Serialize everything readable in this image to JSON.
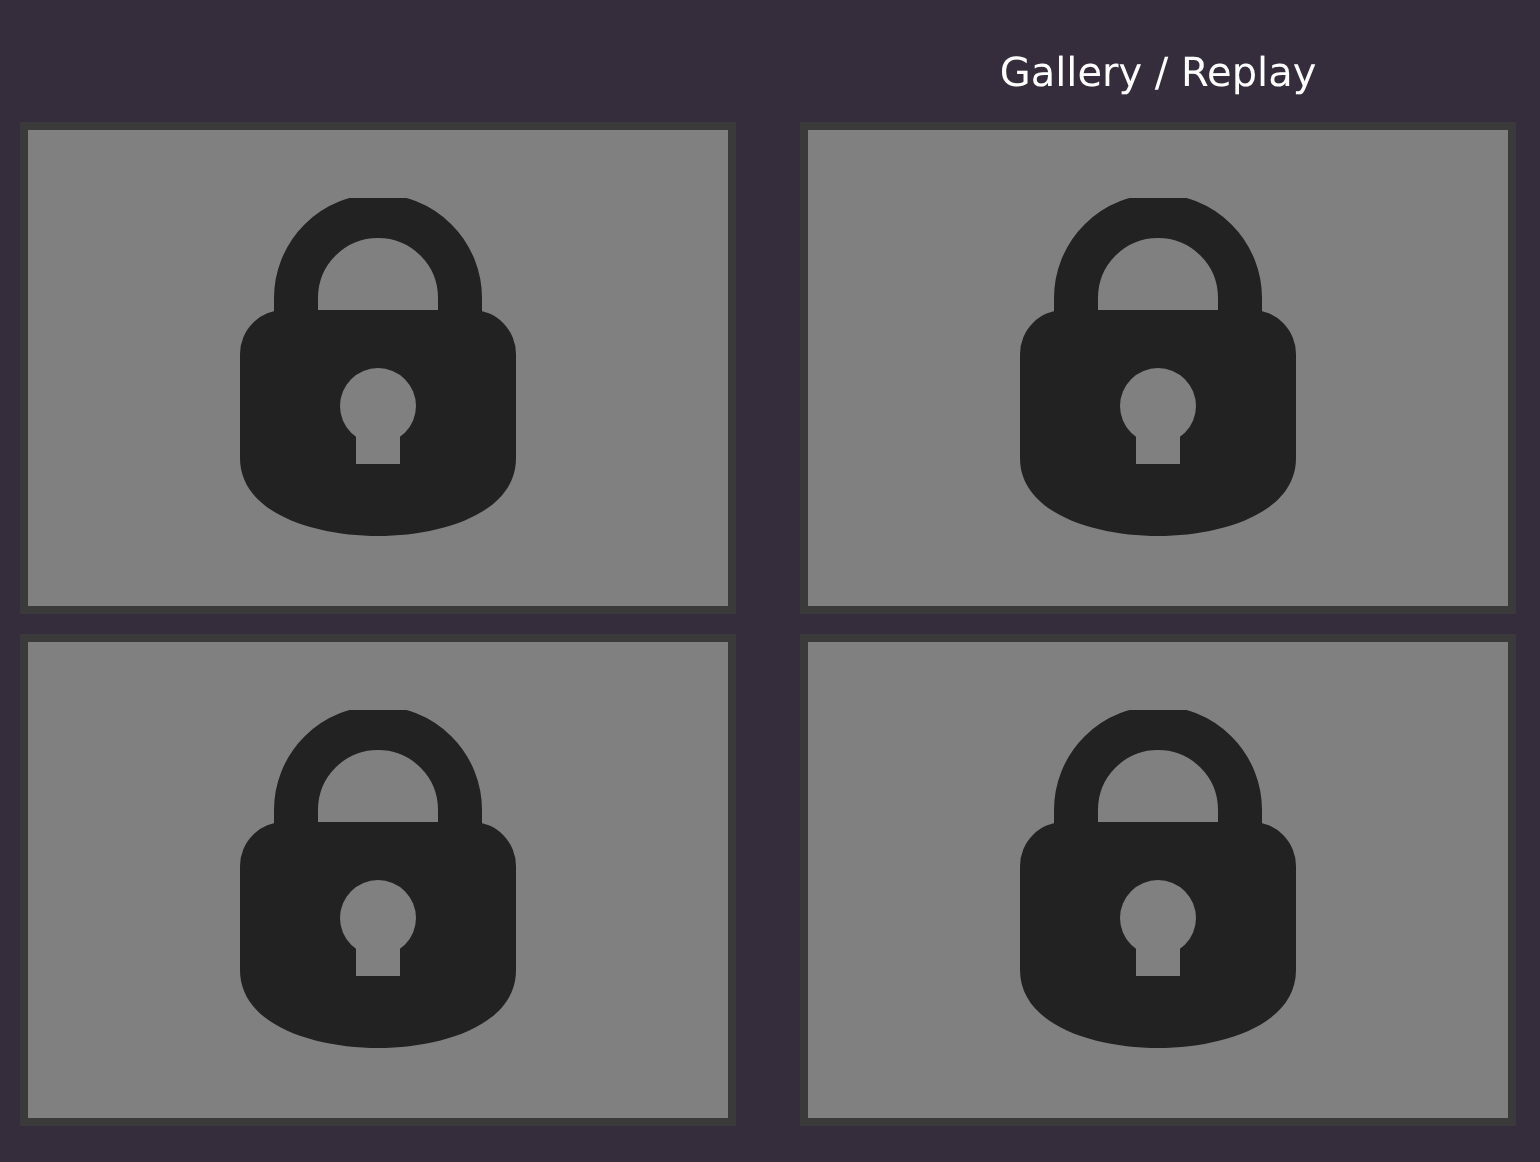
{
  "header": {
    "title": "Gallery / Replay"
  },
  "tiles": [
    {
      "locked": true
    },
    {
      "locked": true
    },
    {
      "locked": true
    },
    {
      "locked": true
    }
  ]
}
